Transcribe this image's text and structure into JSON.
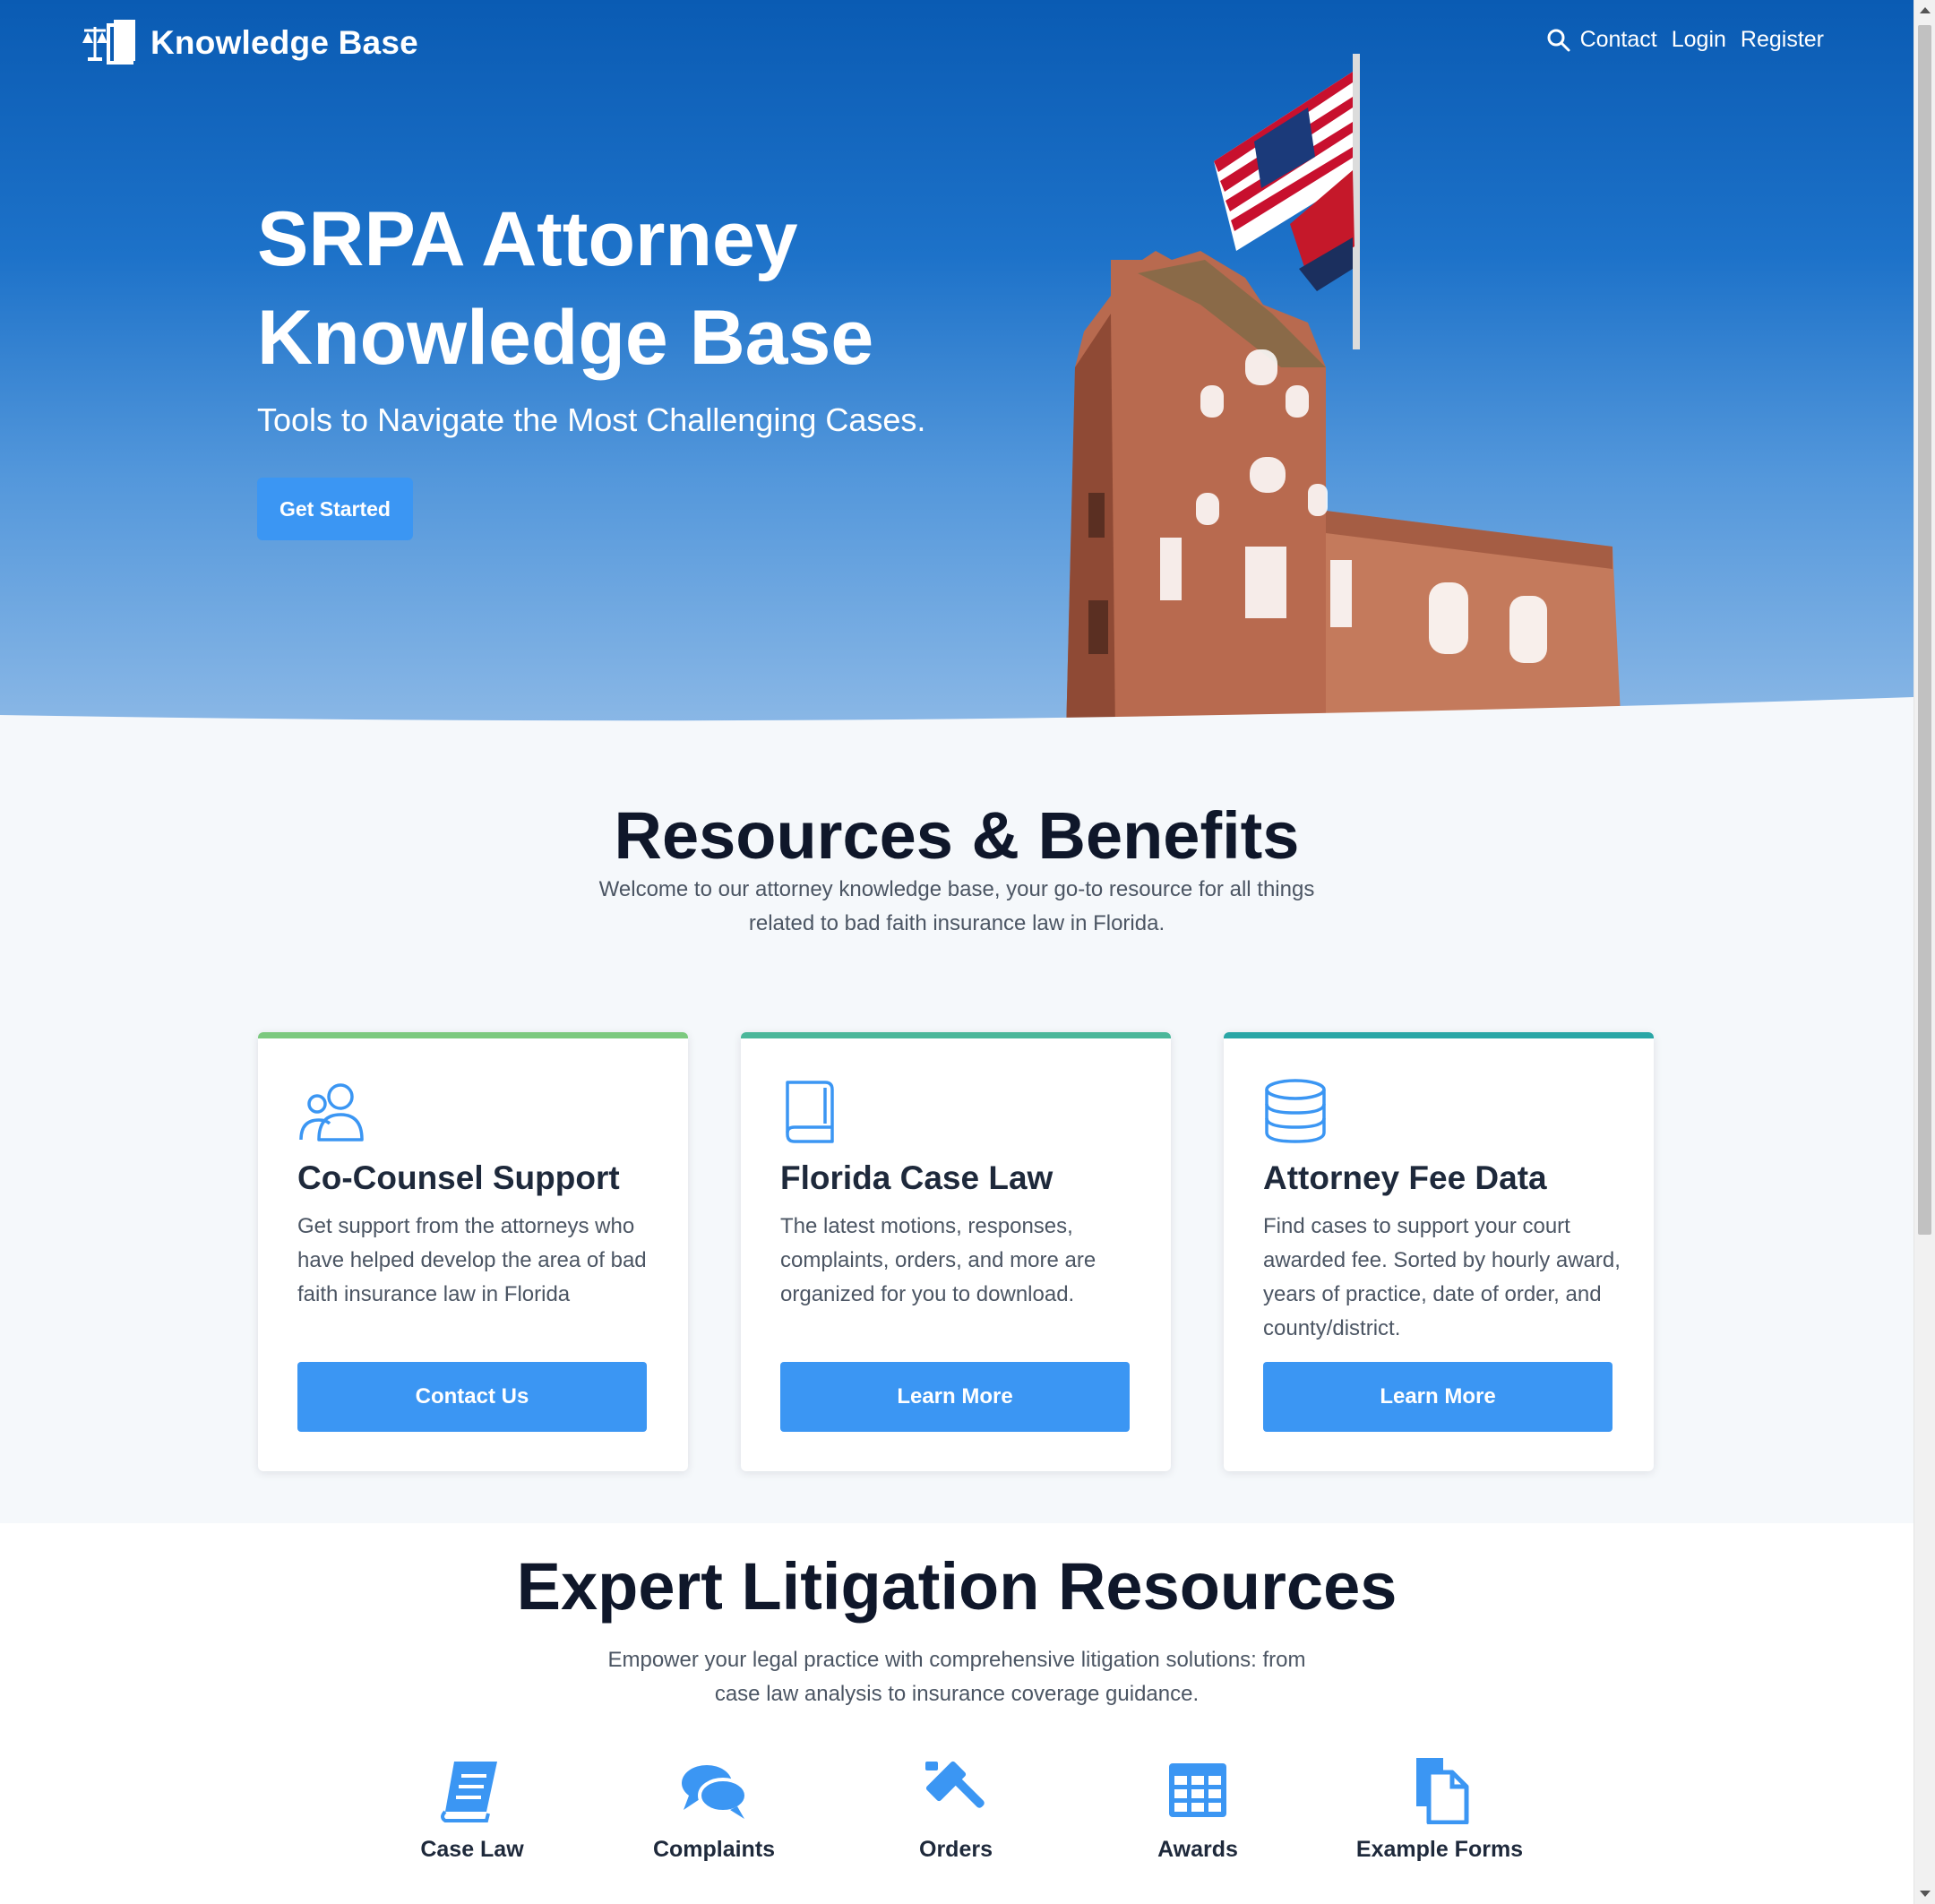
{
  "nav": {
    "brand": "Knowledge Base",
    "links": {
      "contact": "Contact",
      "login": "Login",
      "register": "Register"
    }
  },
  "hero": {
    "title": "SRPA Attorney Knowledge Base",
    "subtitle": "Tools to Navigate the Most Challenging Cases.",
    "cta": "Get Started"
  },
  "resources": {
    "title": "Resources & Benefits",
    "description": "Welcome to our attorney knowledge base, your go-to resource for all things related to bad faith insurance law in Florida.",
    "cards": [
      {
        "icon": "users-icon",
        "title": "Co-Counsel Support",
        "text": "Get support from the attorneys who have helped develop the area of bad faith insurance law in Florida",
        "button": "Contact Us",
        "accent": "#7cc97f"
      },
      {
        "icon": "book-icon",
        "title": "Florida Case Law",
        "text": "The latest motions, responses, complaints, orders, and more are organized for you to download.",
        "button": "Learn More",
        "accent": "#4bb79a"
      },
      {
        "icon": "database-icon",
        "title": "Attorney Fee Data",
        "text": "Find cases to support your court awarded fee. Sorted by hourly award, years of practice, date of order, and county/district.",
        "button": "Learn More",
        "accent": "#2aa6a6"
      }
    ]
  },
  "litigation": {
    "title": "Expert Litigation Resources",
    "description": "Empower your legal practice with comprehensive litigation solutions: from case law analysis to insurance coverage guidance.",
    "items": [
      {
        "icon": "book-icon",
        "label": "Case Law"
      },
      {
        "icon": "comments-icon",
        "label": "Complaints"
      },
      {
        "icon": "gavel-icon",
        "label": "Orders"
      },
      {
        "icon": "table-icon",
        "label": "Awards"
      },
      {
        "icon": "documents-icon",
        "label": "Example Forms"
      }
    ]
  },
  "colors": {
    "primary": "#3b96f3",
    "heading": "#0f172a",
    "body": "#4b5563"
  }
}
